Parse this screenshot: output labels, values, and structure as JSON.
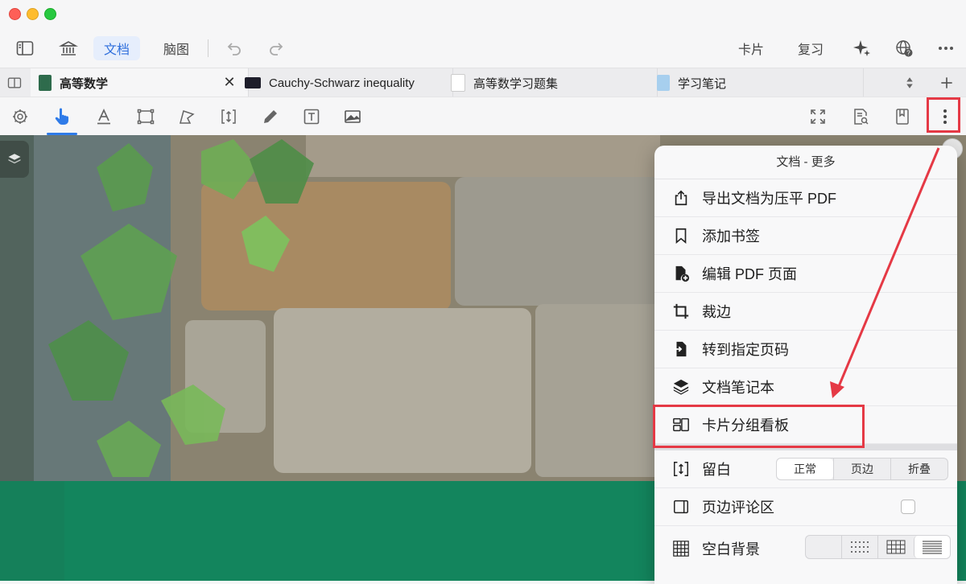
{
  "window": {
    "controls": [
      "close",
      "minimize",
      "zoom"
    ]
  },
  "toolbar": {
    "doc_label": "文档",
    "mindmap_label": "脑图",
    "cards_label": "卡片",
    "review_label": "复习"
  },
  "tabs": [
    {
      "label": "高等数学",
      "active": true
    },
    {
      "label": "Cauchy-Schwarz inequality",
      "active": false
    },
    {
      "label": "高等数学习题集",
      "active": false
    },
    {
      "label": "学习笔记",
      "active": false
    }
  ],
  "menu": {
    "title": "文档 - 更多",
    "items": [
      {
        "label": "导出文档为压平 PDF",
        "icon": "share-icon"
      },
      {
        "label": "添加书签",
        "icon": "bookmark-icon"
      },
      {
        "label": "编辑 PDF 页面",
        "icon": "file-plus-icon"
      },
      {
        "label": "裁边",
        "icon": "crop-icon"
      },
      {
        "label": "转到指定页码",
        "icon": "goto-page-icon"
      },
      {
        "label": "文档笔记本",
        "icon": "layers-icon"
      },
      {
        "label": "卡片分组看板",
        "icon": "board-icon"
      }
    ],
    "margin": {
      "label": "留白",
      "options": [
        "正常",
        "页边",
        "折叠"
      ],
      "selected": "正常"
    },
    "comment_area": {
      "label": "页边评论区",
      "checked": false
    },
    "blank_bg": {
      "label": "空白背景",
      "options": [
        "blank",
        "dots",
        "grid",
        "lines"
      ],
      "selected": "lines"
    }
  },
  "colors": {
    "accent": "#2f7be8",
    "highlight_box": "#e53945",
    "cover_green": "#0f7f58"
  }
}
